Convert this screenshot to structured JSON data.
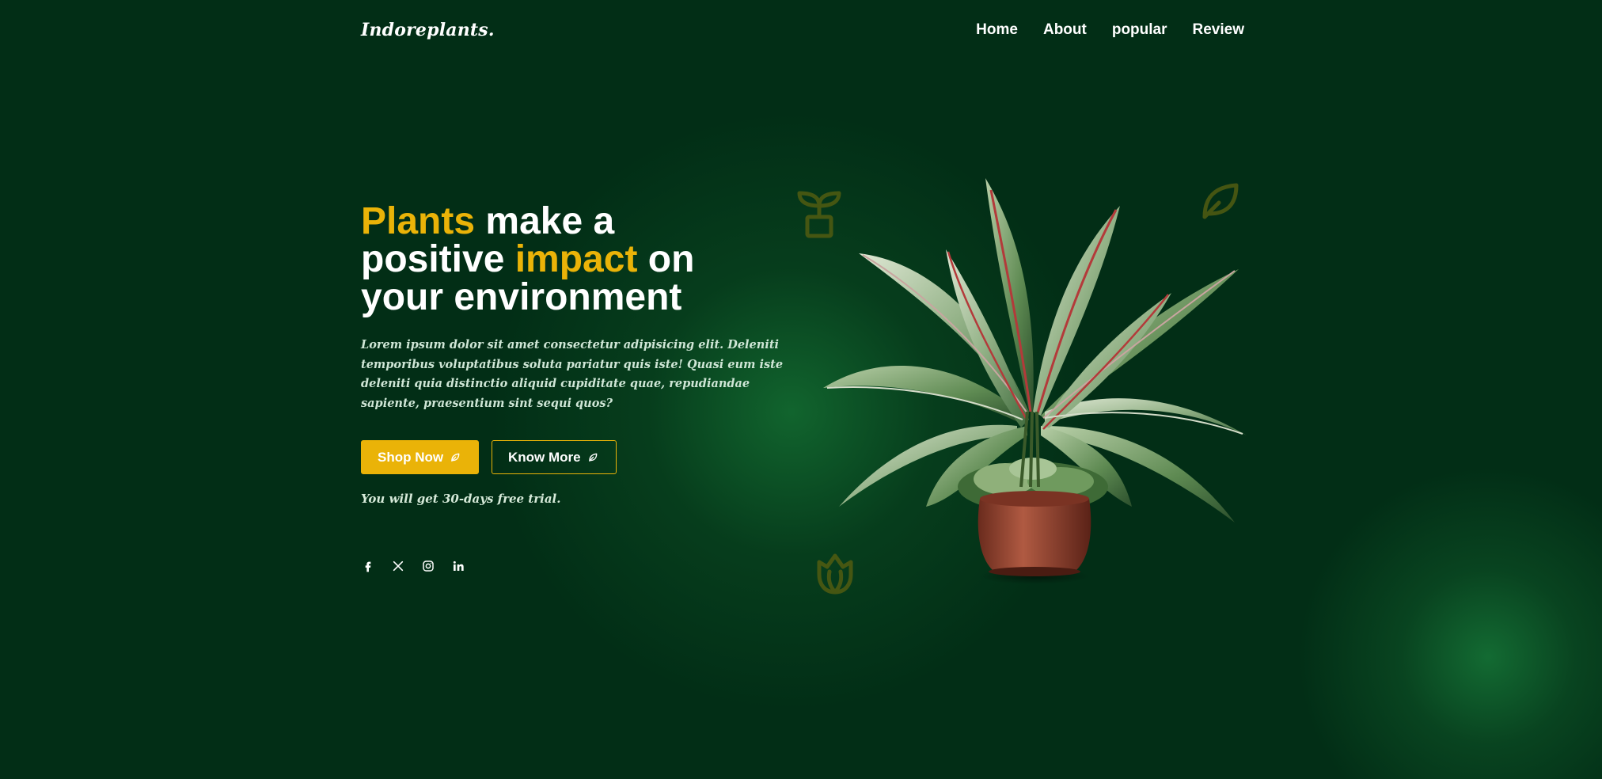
{
  "brand": {
    "logo": "Indoreplants."
  },
  "nav": {
    "items": [
      {
        "label": "Home"
      },
      {
        "label": "About"
      },
      {
        "label": "popular"
      },
      {
        "label": "Review"
      }
    ]
  },
  "hero": {
    "title_parts": {
      "w1": "Plants",
      "w2": " make a",
      "w3": "positive ",
      "w4": "impact",
      "w5": " on",
      "w6": "your environment"
    },
    "description": "Lorem ipsum dolor sit amet consectetur adipisicing elit. Deleniti temporibus voluptatibus soluta pariatur quis iste! Quasi eum iste deleniti quia distinctio aliquid cupiditate quae, repudiandae sapiente, praesentium sint sequi quos?",
    "primary_button": "Shop Now",
    "secondary_button": "Know More",
    "trial_note": "You will get 30-days free trial."
  },
  "socials": [
    {
      "icon": "facebook-icon"
    },
    {
      "icon": "x-icon"
    },
    {
      "icon": "instagram-icon"
    },
    {
      "icon": "linkedin-icon"
    }
  ],
  "colors": {
    "background": "#022e16",
    "accent": "#eab308",
    "glow": "#146e32",
    "deco": "#4d5a12"
  }
}
